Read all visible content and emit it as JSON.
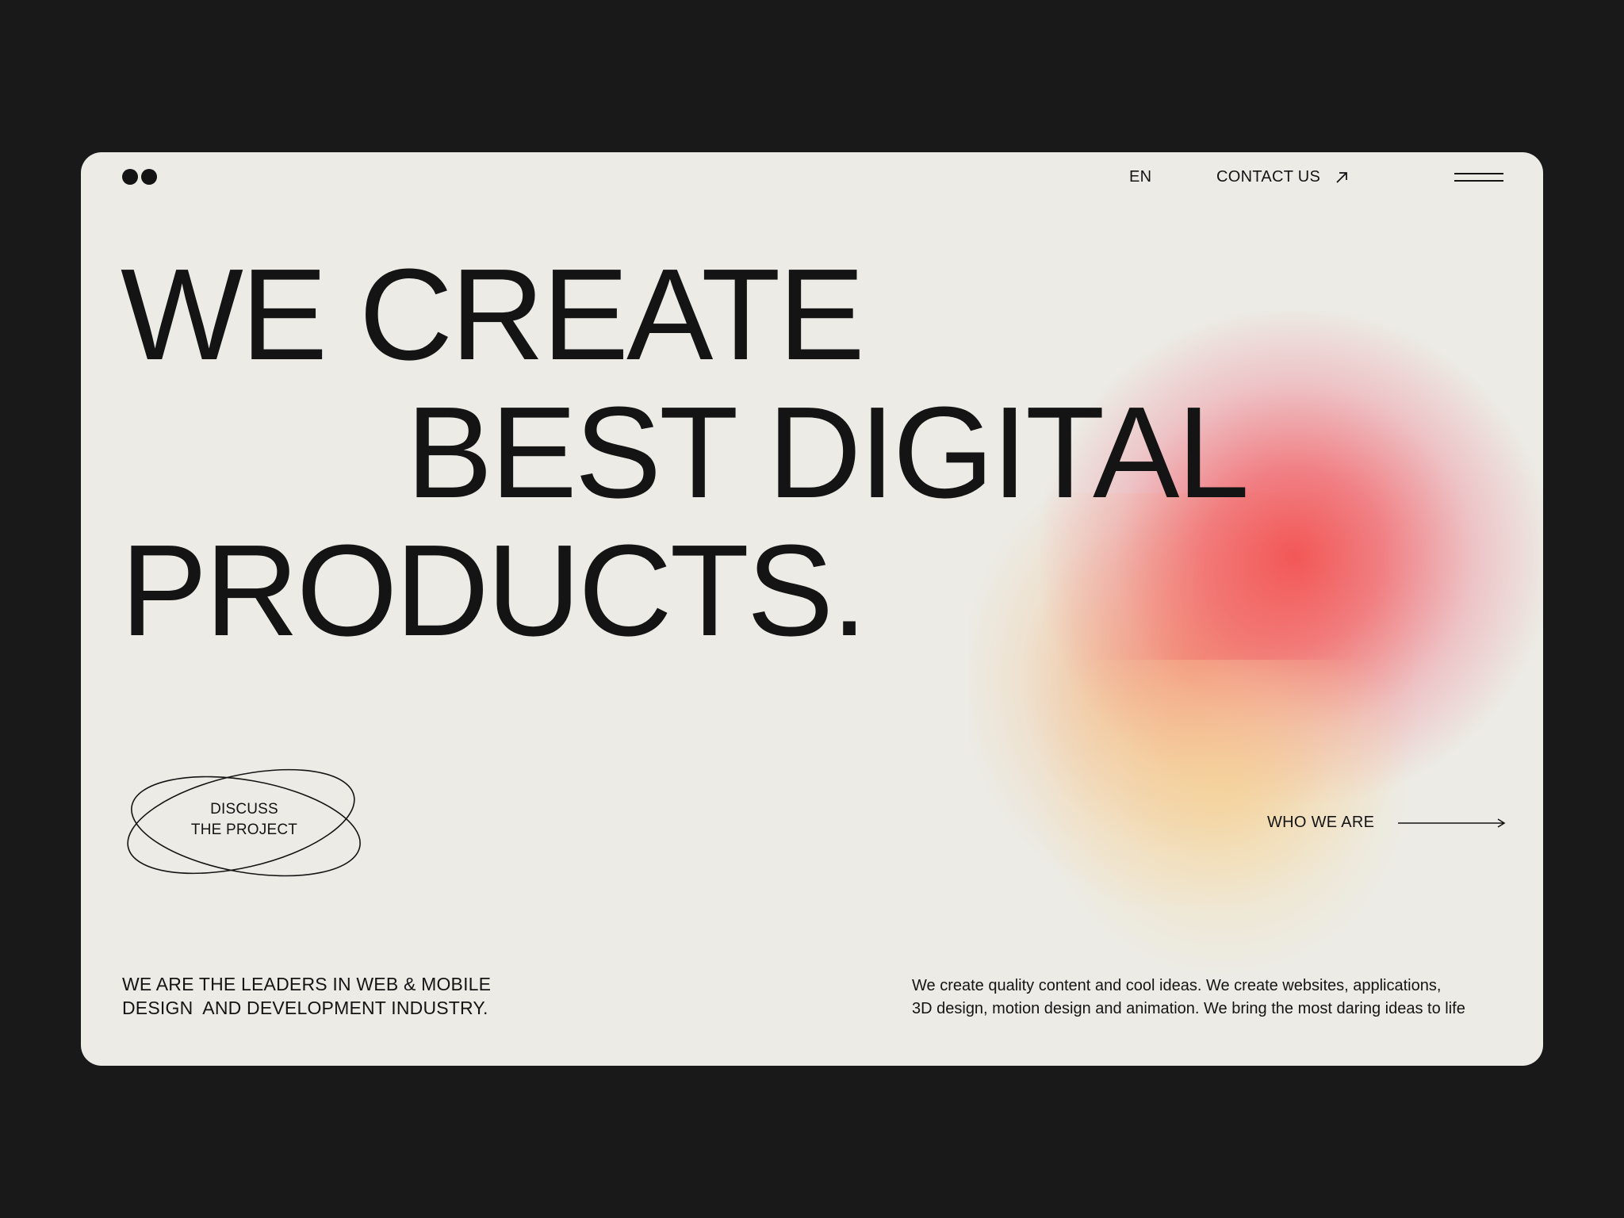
{
  "nav": {
    "language": "EN",
    "contact_label": "CONTACT US"
  },
  "hero": {
    "line1": "WE CREATE",
    "line2": "BEST DIGITAL",
    "line3": "PRODUCTS."
  },
  "cta": {
    "discuss_line1": "DISCUSS",
    "discuss_line2": "THE PROJECT",
    "who_label": "WHO WE ARE"
  },
  "footer": {
    "leaders_line1": "WE ARE THE LEADERS IN WEB & MOBILE",
    "leaders_line2": "DESIGN  AND DEVELOPMENT INDUSTRY.",
    "desc_line1": "We create quality content and cool ideas. We create websites, applications,",
    "desc_line2": "3D design, motion design and animation. We bring the most daring ideas to life"
  },
  "icons": {
    "logo": "two-dots-logo-icon",
    "contact_arrow": "arrow-up-right-icon",
    "menu": "hamburger-menu-icon",
    "who_arrow": "arrow-right-icon"
  },
  "colors": {
    "page_bg": "#191919",
    "card_bg": "#ecebe5",
    "text": "#141414",
    "gradient_red": "#f25050",
    "gradient_orange": "#f6965a",
    "gradient_yellow": "#f6d696"
  }
}
